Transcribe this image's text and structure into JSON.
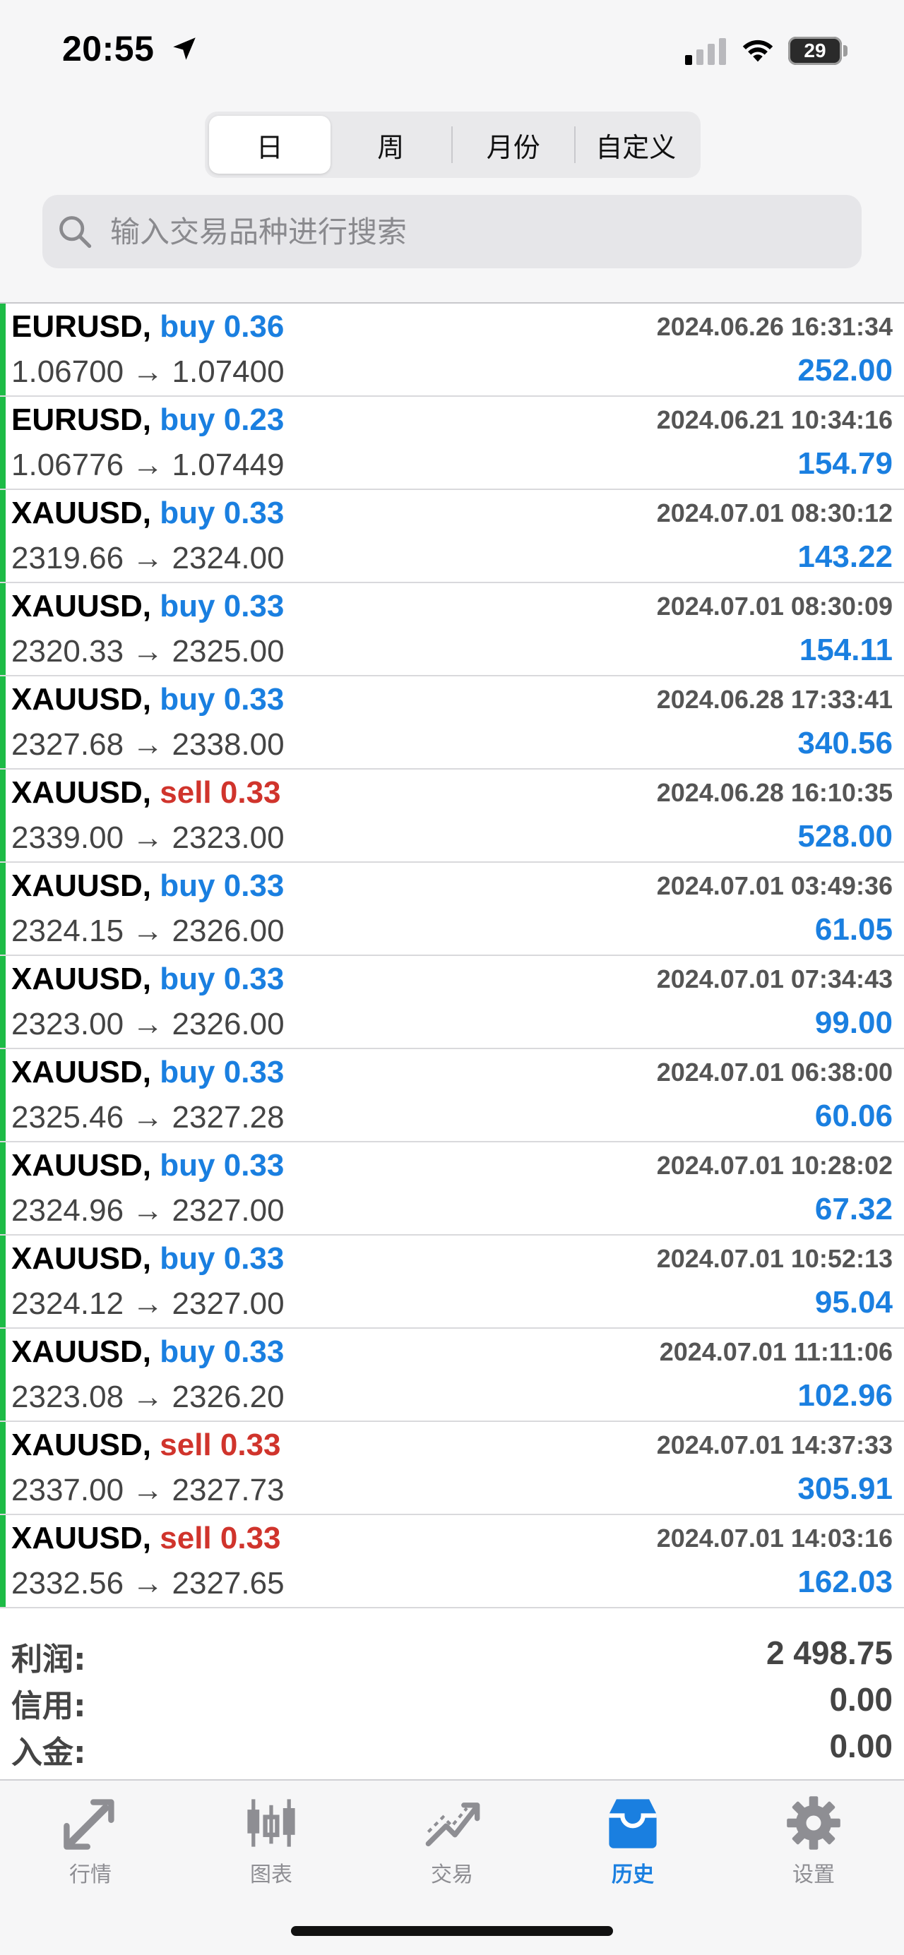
{
  "status": {
    "time": "20:55",
    "battery": "29"
  },
  "segments": [
    {
      "label": "日",
      "active": true
    },
    {
      "label": "周",
      "active": false
    },
    {
      "label": "月份",
      "active": false
    },
    {
      "label": "自定义",
      "active": false
    }
  ],
  "search": {
    "placeholder": "输入交易品种进行搜索"
  },
  "trades": [
    {
      "symbol": "EURUSD,",
      "side": "buy",
      "volume": "0.36",
      "open": "1.06700",
      "close": "1.07400",
      "time": "2024.06.26 16:31:34",
      "profit": "252.00"
    },
    {
      "symbol": "EURUSD,",
      "side": "buy",
      "volume": "0.23",
      "open": "1.06776",
      "close": "1.07449",
      "time": "2024.06.21 10:34:16",
      "profit": "154.79"
    },
    {
      "symbol": "XAUUSD,",
      "side": "buy",
      "volume": "0.33",
      "open": "2319.66",
      "close": "2324.00",
      "time": "2024.07.01 08:30:12",
      "profit": "143.22"
    },
    {
      "symbol": "XAUUSD,",
      "side": "buy",
      "volume": "0.33",
      "open": "2320.33",
      "close": "2325.00",
      "time": "2024.07.01 08:30:09",
      "profit": "154.11"
    },
    {
      "symbol": "XAUUSD,",
      "side": "buy",
      "volume": "0.33",
      "open": "2327.68",
      "close": "2338.00",
      "time": "2024.06.28 17:33:41",
      "profit": "340.56"
    },
    {
      "symbol": "XAUUSD,",
      "side": "sell",
      "volume": "0.33",
      "open": "2339.00",
      "close": "2323.00",
      "time": "2024.06.28 16:10:35",
      "profit": "528.00"
    },
    {
      "symbol": "XAUUSD,",
      "side": "buy",
      "volume": "0.33",
      "open": "2324.15",
      "close": "2326.00",
      "time": "2024.07.01 03:49:36",
      "profit": "61.05"
    },
    {
      "symbol": "XAUUSD,",
      "side": "buy",
      "volume": "0.33",
      "open": "2323.00",
      "close": "2326.00",
      "time": "2024.07.01 07:34:43",
      "profit": "99.00"
    },
    {
      "symbol": "XAUUSD,",
      "side": "buy",
      "volume": "0.33",
      "open": "2325.46",
      "close": "2327.28",
      "time": "2024.07.01 06:38:00",
      "profit": "60.06"
    },
    {
      "symbol": "XAUUSD,",
      "side": "buy",
      "volume": "0.33",
      "open": "2324.96",
      "close": "2327.00",
      "time": "2024.07.01 10:28:02",
      "profit": "67.32"
    },
    {
      "symbol": "XAUUSD,",
      "side": "buy",
      "volume": "0.33",
      "open": "2324.12",
      "close": "2327.00",
      "time": "2024.07.01 10:52:13",
      "profit": "95.04"
    },
    {
      "symbol": "XAUUSD,",
      "side": "buy",
      "volume": "0.33",
      "open": "2323.08",
      "close": "2326.20",
      "time": "2024.07.01 11:11:06",
      "profit": "102.96"
    },
    {
      "symbol": "XAUUSD,",
      "side": "sell",
      "volume": "0.33",
      "open": "2337.00",
      "close": "2327.73",
      "time": "2024.07.01 14:37:33",
      "profit": "305.91"
    },
    {
      "symbol": "XAUUSD,",
      "side": "sell",
      "volume": "0.33",
      "open": "2332.56",
      "close": "2327.65",
      "time": "2024.07.01 14:03:16",
      "profit": "162.03"
    }
  ],
  "summary": {
    "profit_label": "利润:",
    "profit_value": "2 498.75",
    "credit_label": "信用:",
    "credit_value": "0.00",
    "deposit_label": "入金:",
    "deposit_value": "0.00"
  },
  "tabs": [
    {
      "label": "行情",
      "icon": "quotes-icon",
      "active": false
    },
    {
      "label": "图表",
      "icon": "chart-icon",
      "active": false
    },
    {
      "label": "交易",
      "icon": "trade-icon",
      "active": false
    },
    {
      "label": "历史",
      "icon": "history-icon",
      "active": true
    },
    {
      "label": "设置",
      "icon": "settings-icon",
      "active": false
    }
  ],
  "colors": {
    "buy": "#1a7fe0",
    "sell": "#d0342c",
    "profit": "#1a7fe0",
    "bar": "#1dbb46",
    "tab_active": "#1a7fe0",
    "tab_inactive": "#8e8e93"
  },
  "arrow": "→"
}
